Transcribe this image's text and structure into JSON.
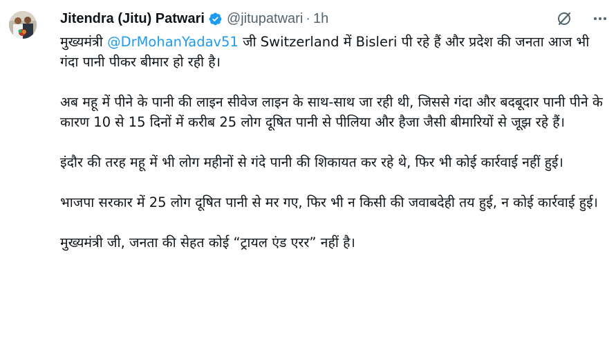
{
  "author": {
    "display_name": "Jitendra (Jitu) Patwari",
    "handle": "@jitupatwari",
    "separator": "·",
    "time": "1h",
    "verified_icon": "verified-badge-icon"
  },
  "actions": {
    "grok_icon": "grok-icon",
    "more_icon": "more-dots-icon"
  },
  "tweet": {
    "p1_pre": "मुख्यमंत्री ",
    "p1_mention": "@DrMohanYadav51",
    "p1_post": " जी Switzerland में Bisleri पी रहे हैं और प्रदेश की जनता आज भी गंदा पानी पीकर बीमार हो रही है।",
    "p2": "अब महू में पीने के पानी की लाइन सीवेज लाइन के साथ-साथ जा रही थी, जिससे गंदा और बदबूदार पानी पीने के कारण 10 से 15 दिनों में करीब 25 लोग दूषित पानी से पीलिया और हैजा जैसी बीमारियों से जूझ रहे हैं।",
    "p3": "इंदौर की तरह महू में भी लोग महीनों से गंदे पानी की शिकायत कर रहे थे, फिर भी कोई कार्रवाई नहीं हुई।",
    "p4": "भाजपा सरकार में 25 लोग दूषित पानी से मर गए, फिर भी न किसी की जवाबदेही तय हुई, न कोई कार्रवाई हुई।",
    "p5": "मुख्यमंत्री जी, जनता की सेहत कोई “ट्रायल एंड एरर” नहीं है।"
  },
  "colors": {
    "text": "#0f1419",
    "secondary": "#536471",
    "link": "#1d9bf0",
    "verified": "#1d9bf0"
  }
}
